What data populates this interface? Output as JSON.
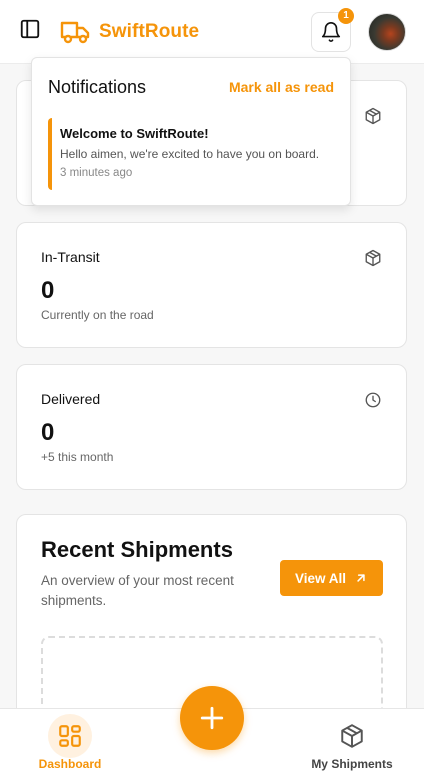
{
  "app": {
    "name": "SwiftRoute",
    "accent": "#f5940a"
  },
  "header": {
    "notification_count": "1"
  },
  "notifications": {
    "title": "Notifications",
    "mark_all_label": "Mark all as read",
    "items": [
      {
        "title": "Welcome to SwiftRoute!",
        "message": "Hello aimen, we're excited to have you on board.",
        "time": "3 minutes ago"
      }
    ]
  },
  "stats": [
    {
      "label": "In-Transit",
      "value": "0",
      "sub": "Currently on the road",
      "icon": "package-icon"
    },
    {
      "label": "Delivered",
      "value": "0",
      "sub": "+5 this month",
      "icon": "clock-icon"
    }
  ],
  "recent": {
    "title": "Recent Shipments",
    "description": "An overview of your most recent shipments.",
    "view_all_label": "View All"
  },
  "bottom_nav": {
    "items": [
      {
        "label": "Dashboard",
        "icon": "dashboard-icon",
        "active": true
      },
      {
        "label": "My Shipments",
        "icon": "package-icon",
        "active": false
      }
    ],
    "fab_icon": "plus-icon"
  }
}
